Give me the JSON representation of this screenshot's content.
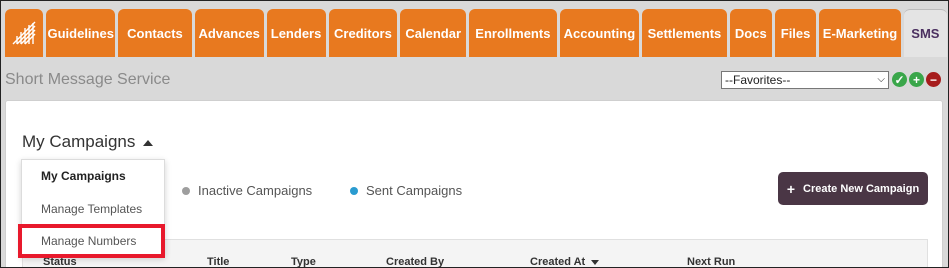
{
  "nav": {
    "logo_icon": "app-logo-icon",
    "tabs": [
      {
        "label": "Guidelines",
        "width": 70
      },
      {
        "label": "Contacts",
        "width": 75
      },
      {
        "label": "Advances",
        "width": 70
      },
      {
        "label": "Lenders",
        "width": 60
      },
      {
        "label": "Creditors",
        "width": 70
      },
      {
        "label": "Calendar",
        "width": 67
      },
      {
        "label": "Enrollments",
        "width": 89
      },
      {
        "label": "Accounting",
        "width": 81
      },
      {
        "label": "Settlements",
        "width": 86
      },
      {
        "label": "Docs",
        "width": 43
      },
      {
        "label": "Files",
        "width": 42
      },
      {
        "label": "E-Marketing",
        "width": 83
      }
    ],
    "active_tab": "SMS",
    "accent_color": "#e8791f"
  },
  "header": {
    "title": "Short Message Service",
    "favorites_value": "--Favorites--",
    "icons": [
      "check-icon",
      "plus-icon",
      "minus-icon"
    ]
  },
  "main": {
    "campaigns_title": "My Campaigns",
    "filters": {
      "inactive": "Inactive Campaigns",
      "sent": "Sent Campaigns"
    },
    "create_button": "Create New Campaign",
    "columns": [
      "Status",
      "Title",
      "Type",
      "Created By",
      "Created At",
      "Next Run"
    ]
  },
  "dropdown": {
    "items": [
      "My Campaigns",
      "Manage Templates",
      "Manage Numbers"
    ],
    "selected": "My Campaigns",
    "highlighted": "Manage Numbers",
    "highlight_color": "#e8192c"
  }
}
